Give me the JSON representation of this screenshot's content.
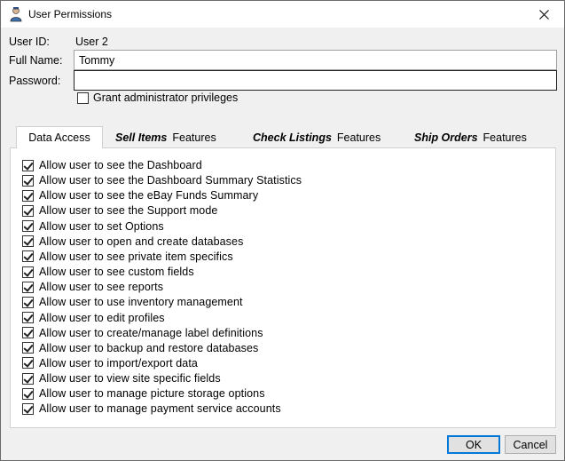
{
  "window": {
    "title": "User Permissions"
  },
  "form": {
    "user_id_label": "User ID:",
    "user_id_value": "User 2",
    "full_name_label": "Full Name:",
    "full_name_value": "Tommy",
    "password_label": "Password:",
    "password_value": "",
    "admin_label": "Grant administrator privileges",
    "admin_checked": false
  },
  "tabs": [
    {
      "label": "Data Access",
      "active": true
    },
    {
      "bold": "Sell Items",
      "label": "Features",
      "active": false
    },
    {
      "bold": "Check Listings",
      "label": "Features",
      "active": false
    },
    {
      "bold": "Ship Orders",
      "label": "Features",
      "active": false
    }
  ],
  "permissions": [
    {
      "label": "Allow user to see the Dashboard",
      "checked": true
    },
    {
      "label": "Allow user to see the Dashboard Summary Statistics",
      "checked": true
    },
    {
      "label": "Allow user to see the eBay Funds Summary",
      "checked": true
    },
    {
      "label": "Allow user to see the Support mode",
      "checked": true
    },
    {
      "label": "Allow user to set Options",
      "checked": true
    },
    {
      "label": "Allow user to open and create databases",
      "checked": true
    },
    {
      "label": "Allow user to see private item specifics",
      "checked": true
    },
    {
      "label": "Allow user to see custom fields",
      "checked": true
    },
    {
      "label": "Allow user to see reports",
      "checked": true
    },
    {
      "label": "Allow user to use inventory management",
      "checked": true
    },
    {
      "label": "Allow user to edit profiles",
      "checked": true
    },
    {
      "label": "Allow user to create/manage label definitions",
      "checked": true
    },
    {
      "label": "Allow user to backup and restore databases",
      "checked": true
    },
    {
      "label": "Allow user to import/export data",
      "checked": true
    },
    {
      "label": "Allow user to view site specific fields",
      "checked": true
    },
    {
      "label": "Allow user to manage picture storage options",
      "checked": true
    },
    {
      "label": "Allow user to manage payment service accounts",
      "checked": true
    }
  ],
  "buttons": {
    "ok": "OK",
    "cancel": "Cancel"
  },
  "icons": {
    "app": "user-icon",
    "close": "close-icon"
  },
  "colors": {
    "accent": "#0078d7",
    "panel": "#ffffff",
    "background": "#f0f0f0"
  }
}
